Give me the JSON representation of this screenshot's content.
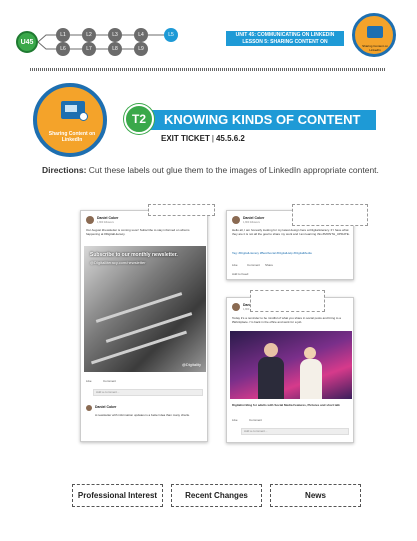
{
  "header": {
    "unit_badge": "U45",
    "lessons_top": [
      "L1",
      "L2",
      "L3",
      "L4",
      "L5"
    ],
    "lessons_bottom": [
      "L6",
      "L7",
      "L8",
      "L9"
    ],
    "unit_line": "UNIT 45: COMMUNICATING ON LINKEDIN",
    "lesson_line": "LESSON 5: SHARING CONTENT ON LINKEDIN",
    "logo_small_caption": "Sharing Content on LinkedIn"
  },
  "logo_caption": "Sharing Content on LinkedIn",
  "title": {
    "badge": "T2",
    "text": "KNOWING KINDS OF CONTENT",
    "ticket_label": "EXIT TICKET",
    "ticket_sep": "|",
    "ticket_code": "45.5.6.2"
  },
  "directions": {
    "label": "Directions:",
    "text": "Cut these labels out glue them to the images of LinkedIn appropriate content."
  },
  "post1": {
    "name": "Daniel Coker",
    "sub": "1,800 followers",
    "text": "Our August #newsletter is coming soon! Subscribe to stay informed on what is happening at #DigitalLiteracy.",
    "image_text": "Subscribe to our monthly newsletter.",
    "image_sub": "@Digitalliteracy.com/newsletter",
    "watermark": "@Digitality",
    "like": "Like",
    "comment": "Comment",
    "add_comment": "Add a comment...",
    "reply_name": "Daniel Coker",
    "reply_text": "A newsletter with information updates is a better idea than many charts."
  },
  "post2": {
    "name": "Daniel Coker",
    "sub": "1,800 followers",
    "text": "Hello all, I am honestly looking for my latest design here at DigitalLiteracy. If I have what they are it is not all the goal to share my work and I am learning this #MONTH_UPDATE.",
    "tags": "Tag: #DigitalLiteracy #BestSocial #DigitalHelp #DigitalMedia",
    "like": "Like",
    "comment": "Comment",
    "share": "Share",
    "footer": "Add to Feed"
  },
  "post3": {
    "name": "Daniel Coker",
    "sub": "1,800 followers",
    "text": "Today it's a reminder to be mindful of what you share in social posts and bring to a #Workplace. I'm back in the office and work for a job.",
    "caption": "Digitalist Blog for adults with Social Media Features, Pictures and short talk",
    "reactions": "Like",
    "comment": "Comment",
    "add_comment": "Add a comment..."
  },
  "labels": [
    "Professional Interest",
    "Recent Changes",
    "News"
  ]
}
